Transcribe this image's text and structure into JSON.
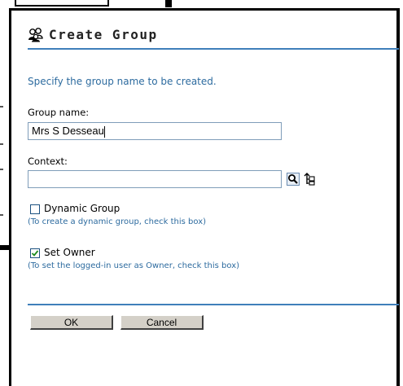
{
  "dialog": {
    "title": "Create Group",
    "icon": "group-icon",
    "description": "Specify the group name to be created."
  },
  "form": {
    "group_name_label": "Group name:",
    "group_name_value": "Mrs S Desseau",
    "context_label": "Context:",
    "context_value": "",
    "context_search_icon": "search-icon",
    "context_browse_icon": "tree-browse-icon",
    "dynamic_group": {
      "label": "Dynamic Group",
      "checked": false,
      "hint": "(To create a dynamic group, check this box)"
    },
    "set_owner": {
      "label": "Set Owner",
      "checked": true,
      "hint": "(To set the logged-in user as Owner, check this box)"
    }
  },
  "buttons": {
    "ok_label": "OK",
    "cancel_label": "Cancel"
  },
  "colors": {
    "accent": "#3f7fba",
    "hint_text": "#2d6b9f",
    "button_face": "#d4d0c8"
  }
}
